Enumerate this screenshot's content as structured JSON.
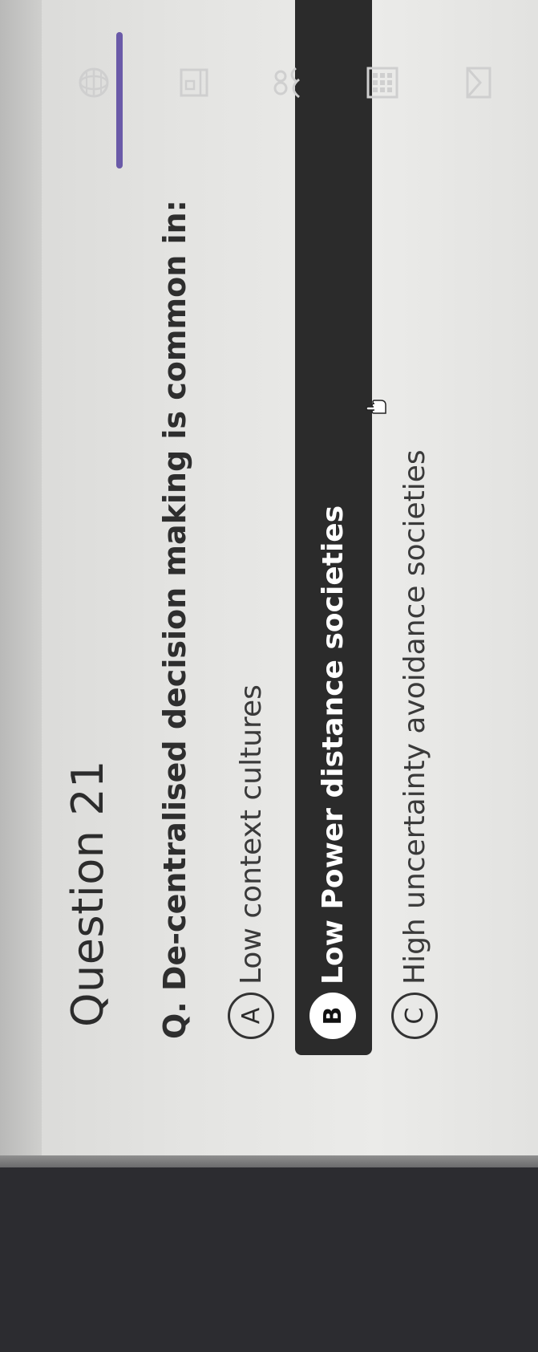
{
  "question": {
    "title": "Question 21",
    "text": "Q. De-centralised decision making is common in:"
  },
  "options": [
    {
      "letter": "A",
      "label": "Low context cultures",
      "selected": false
    },
    {
      "letter": "B",
      "label": "Low Power distance societies",
      "selected": true
    },
    {
      "letter": "C",
      "label": "High uncertainty avoidance societies",
      "selected": false
    }
  ],
  "colors": {
    "page_background": "#e4e4e2",
    "selected_bar": "#2b2b2b",
    "nav_background": "#2c2c30",
    "nav_accent": "#6a5aa8"
  },
  "nav": {
    "icons": [
      "globe-icon",
      "book-icon",
      "people-icon",
      "grid-icon",
      "mail-icon"
    ]
  }
}
